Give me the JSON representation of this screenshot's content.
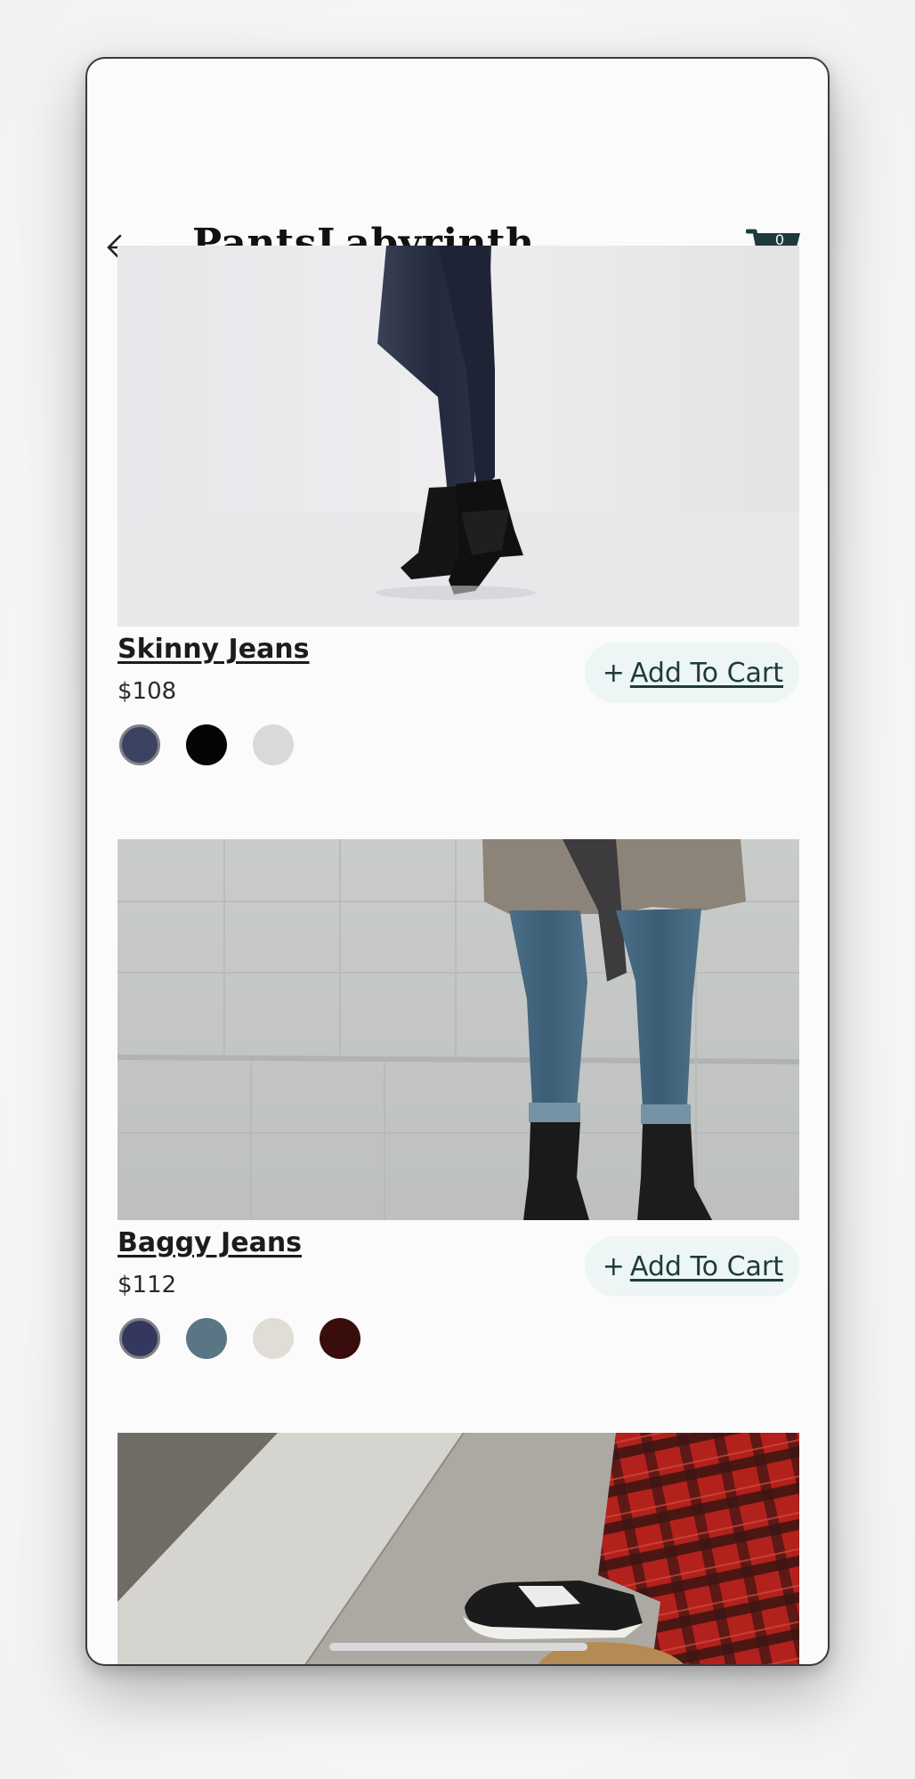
{
  "header": {
    "brand": "PantsLabyrinth",
    "cart_count": "0"
  },
  "products": [
    {
      "name": "Skinny Jeans",
      "price": "$108",
      "add_plus": "+",
      "add_label": "Add To Cart",
      "swatches": [
        "#3b4262",
        "#050505",
        "#d9d8da"
      ]
    },
    {
      "name": "Baggy Jeans",
      "price": "$112",
      "add_plus": "+",
      "add_label": "Add To Cart",
      "swatches": [
        "#34385e",
        "#5a7685",
        "#e0dcd6",
        "#3a0d0d"
      ]
    }
  ],
  "colors": {
    "accent": "#1f3a3a",
    "button_bg": "#edf5f5",
    "text": "#1c1c1c"
  },
  "icons": {
    "back": "arrow-left-icon",
    "cart": "shopping-cart-icon"
  }
}
